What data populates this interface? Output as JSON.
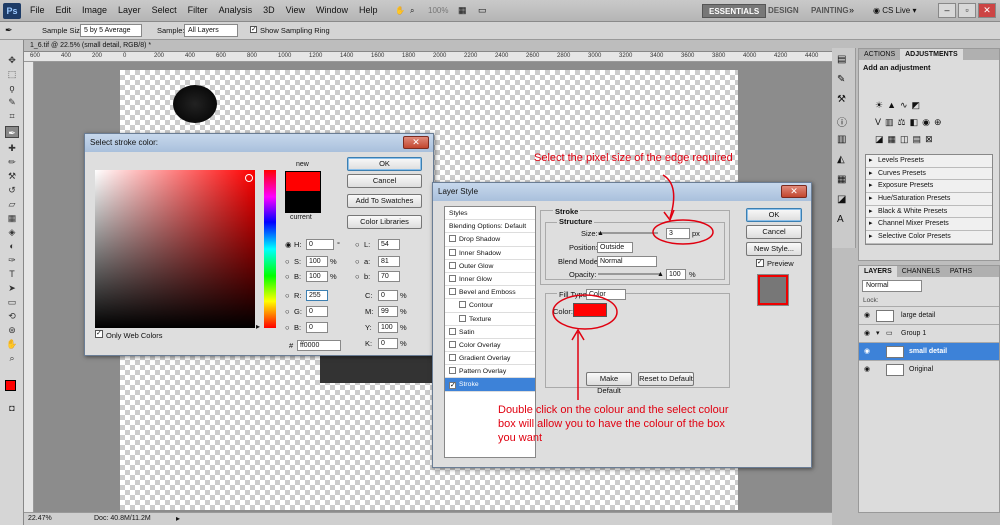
{
  "menubar": {
    "app": "Ps",
    "menus": [
      "File",
      "Edit",
      "Image",
      "Layer",
      "Select",
      "Filter",
      "Analysis",
      "3D",
      "View",
      "Window",
      "Help"
    ],
    "zoom": "100%",
    "workspaces": [
      "ESSENTIALS",
      "DESIGN",
      "PAINTING"
    ],
    "cslive": "CS Live"
  },
  "options": {
    "sample_size_label": "Sample Size:",
    "sample_size": "5 by 5 Average",
    "sample_label": "Sample:",
    "sample": "All Layers",
    "ring_label": "Show Sampling Ring"
  },
  "document": {
    "tab": "1_6.tif @ 22.5% (small detail, RGB/8) *",
    "zoom": "22.47%",
    "doc": "Doc: 40.8M/11.2M"
  },
  "ruler_ticks": [
    "600",
    "400",
    "200",
    "0",
    "200",
    "400",
    "600",
    "800",
    "1000",
    "1200",
    "1400",
    "1600",
    "1800",
    "2000",
    "2200",
    "2400",
    "2600",
    "2800",
    "3000",
    "3200",
    "3400",
    "3600",
    "3800",
    "4000",
    "4200",
    "4400"
  ],
  "color_picker": {
    "title": "Select stroke color:",
    "new_label": "new",
    "current_label": "current",
    "ok": "OK",
    "cancel": "Cancel",
    "add_swatches": "Add To Swatches",
    "color_libraries": "Color Libraries",
    "only_web": "Only Web Colors",
    "fields": {
      "H": "0",
      "S": "100",
      "B": "100",
      "R": "255",
      "G": "0",
      "Bv": "0",
      "L": "54",
      "a": "81",
      "b": "70",
      "C": "0",
      "M": "99",
      "Y": "100",
      "K": "0",
      "hex": "ff0000"
    },
    "labels": {
      "H": "H:",
      "S": "S:",
      "B": "B:",
      "R": "R:",
      "G": "G:",
      "Bv": "B:",
      "L": "L:",
      "a": "a:",
      "b": "b:",
      "C": "C:",
      "M": "M:",
      "Y": "Y:",
      "K": "K:",
      "hex": "#"
    },
    "units": {
      "deg": "°",
      "pct": "%"
    }
  },
  "layer_style": {
    "title": "Layer Style",
    "items": [
      "Styles",
      "Blending Options: Default",
      "Drop Shadow",
      "Inner Shadow",
      "Outer Glow",
      "Inner Glow",
      "Bevel and Emboss",
      "Contour",
      "Texture",
      "Satin",
      "Color Overlay",
      "Gradient Overlay",
      "Pattern Overlay",
      "Stroke"
    ],
    "stroke_title": "Stroke",
    "structure_title": "Structure",
    "size_label": "Size:",
    "size": "3",
    "size_unit": "px",
    "position_label": "Position:",
    "position": "Outside",
    "blend_label": "Blend Mode:",
    "blend": "Normal",
    "opacity_label": "Opacity:",
    "opacity": "100",
    "opacity_unit": "%",
    "fill_type_label": "Fill Type:",
    "fill_type": "Color",
    "color_label": "Color:",
    "make_default": "Make Default",
    "reset_default": "Reset to Default",
    "ok": "OK",
    "cancel": "Cancel",
    "new_style": "New Style...",
    "preview": "Preview"
  },
  "panels": {
    "tabs1": [
      "ACTIONS",
      "ADJUSTMENTS"
    ],
    "adj_header": "Add an adjustment",
    "presets": [
      "Levels Presets",
      "Curves Presets",
      "Exposure Presets",
      "Hue/Saturation Presets",
      "Black & White Presets",
      "Channel Mixer Presets",
      "Selective Color Presets"
    ],
    "tabs2": [
      "LAYERS",
      "CHANNELS",
      "PATHS"
    ],
    "blend": "Normal",
    "lock": "Lock:",
    "layers": [
      "large detail",
      "Group 1",
      "small detail",
      "Original"
    ]
  },
  "annotations": {
    "top": "Select the pixel size of the edge required",
    "bottom": "Double click on the colour and the select colour box will allow you to have the colour of the box you want"
  },
  "colors": {
    "accent": "#e00010",
    "stroke": "#ff0000",
    "selection": "#3d82d8"
  }
}
